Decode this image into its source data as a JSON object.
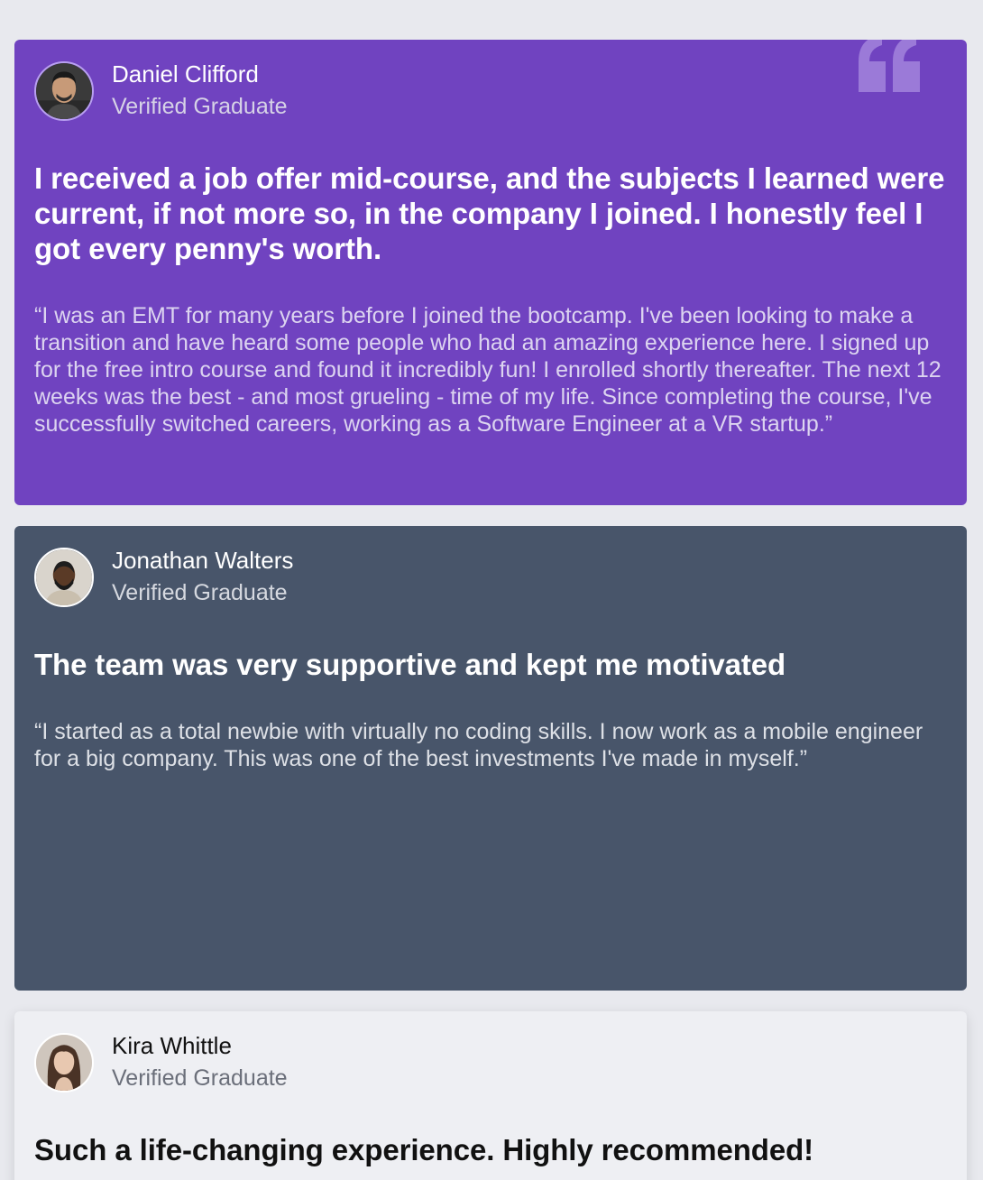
{
  "testimonials": [
    {
      "name": "Daniel Clifford",
      "role": "Verified Graduate",
      "headline": "I received a job offer mid-course, and the subjects I learned were current, if not more so, in the company I joined. I honestly feel I got every penny's worth.",
      "quote": "“I was an EMT for many years before I joined the bootcamp. I've been looking to make a transition and have heard some people who had an amazing experience here. I signed up for the free intro course and found it incredibly fun! I enrolled shortly thereafter. The next 12 weeks was the best - and most grueling - time of my life. Since completing the course, I've successfully switched careers, working as a Software Engineer at a VR startup.”",
      "avatar_icon": "avatar-photo-icon",
      "background": "#7043c0"
    },
    {
      "name": "Jonathan Walters",
      "role": "Verified Graduate",
      "headline": "The team was very supportive and kept me motivated",
      "quote": "“I started as a total newbie with virtually no coding skills. I now work as a mobile engineer for a big company. This was one of the best investments I've made in myself.”",
      "avatar_icon": "avatar-photo-icon",
      "background": "#48556a"
    },
    {
      "name": "Kira Whittle",
      "role": "Verified Graduate",
      "headline": "Such a life-changing experience. Highly recommended!",
      "avatar_icon": "avatar-photo-icon",
      "background": "#eeeff3"
    }
  ],
  "decor": {
    "quote_mark_icon": "quotation-mark-icon",
    "quote_mark_color": "#9b7ad8"
  }
}
